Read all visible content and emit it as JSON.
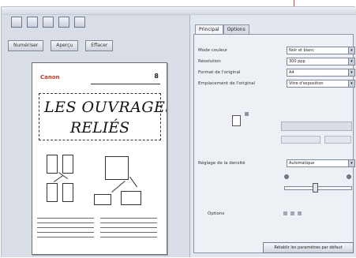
{
  "toolbar": {
    "icons": [
      "page-icon",
      "page-icon",
      "printer-icon",
      "pen-icon",
      "page-icon"
    ]
  },
  "preview_buttons": [
    "Numériser",
    "Aperçu",
    "Effacer"
  ],
  "preview_page": {
    "brand": "Canon",
    "page_number": "8",
    "title_line1": "LES OUVRAGES",
    "title_line2": "RELIÉS"
  },
  "tabs": [
    "Principal",
    "Options"
  ],
  "settings": [
    {
      "label": "Mode couleur",
      "value": "Noir et blanc"
    },
    {
      "label": "Résolution",
      "value": "300 ppp"
    },
    {
      "label": "Format de l'original",
      "value": "A4"
    },
    {
      "label": "Emplacement de l'original",
      "value": "Vitre d'exposition"
    }
  ],
  "density": {
    "label": "Réglage de la densité",
    "value": "Automatique"
  },
  "options_label": "Options",
  "defaults_button": "Rétablir les paramètres par défaut",
  "colors": {
    "accent": "#d6453a",
    "panel": "#e3e7ee",
    "brand": "#c0392b"
  }
}
